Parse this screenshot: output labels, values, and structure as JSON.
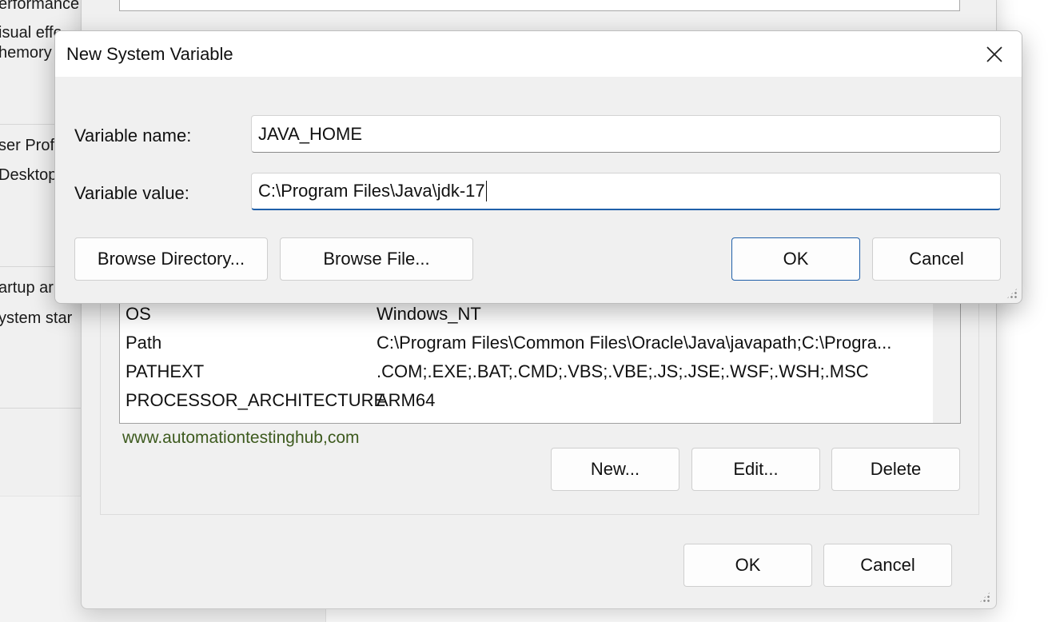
{
  "background_window": {
    "partial_labels": [
      "erformance",
      "isual effe",
      "hemory",
      "ser Profi",
      "Desktop",
      "artup ar",
      "ystem star"
    ]
  },
  "env_window": {
    "system_variables": [
      {
        "name": "OS",
        "value": "Windows_NT"
      },
      {
        "name": "Path",
        "value": "C:\\Program Files\\Common Files\\Oracle\\Java\\javapath;C:\\Progra..."
      },
      {
        "name": "PATHEXT",
        "value": ".COM;.EXE;.BAT;.CMD;.VBS;.VBE;.JS;.JSE;.WSF;.WSH;.MSC"
      },
      {
        "name": "PROCESSOR_ARCHITECTURE",
        "value": "ARM64"
      }
    ],
    "watermark": "www.automationtestinghub,com",
    "new_label": "New...",
    "edit_label": "Edit...",
    "delete_label": "Delete",
    "ok_label": "OK",
    "cancel_label": "Cancel"
  },
  "dialog": {
    "title": "New System Variable",
    "close_icon": "close-icon",
    "variable_name_label": "Variable name:",
    "variable_name_value": "JAVA_HOME",
    "variable_value_label": "Variable value:",
    "variable_value_value": "C:\\Program Files\\Java\\jdk-17",
    "browse_directory_label": "Browse Directory...",
    "browse_file_label": "Browse File...",
    "ok_label": "OK",
    "cancel_label": "Cancel"
  },
  "colors": {
    "accent": "#1f5fa9",
    "watermark": "#3d5a1e",
    "dialog_bg": "#f0f0f0"
  }
}
